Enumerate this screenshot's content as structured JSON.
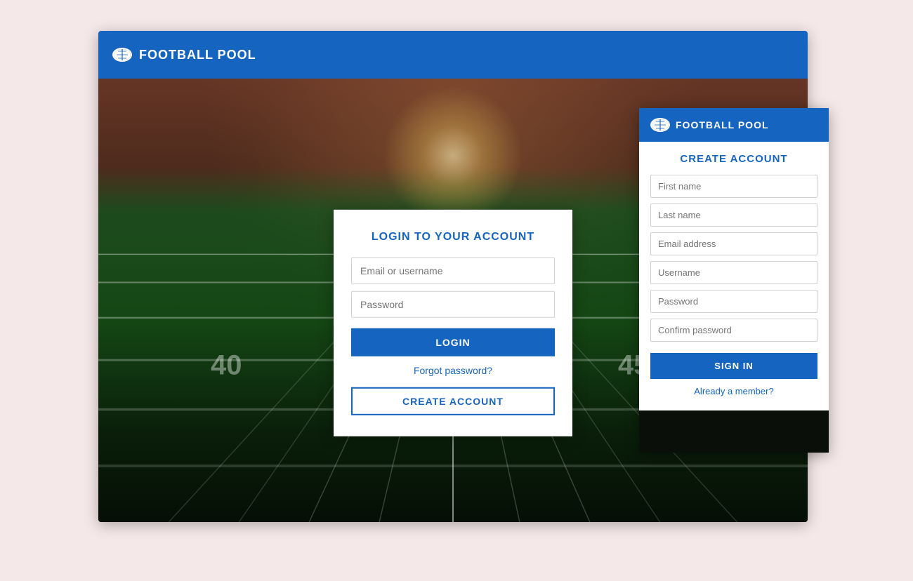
{
  "colors": {
    "primary": "#1565c0",
    "white": "#ffffff",
    "bg": "#f5e8e8"
  },
  "main_app": {
    "header": {
      "logo_icon": "football-icon",
      "title": "FOOTBALL POOL"
    },
    "login_form": {
      "title": "LOGIN TO YOUR ACCOUNT",
      "email_placeholder": "Email or username",
      "password_placeholder": "Password",
      "login_button": "LOGIN",
      "forgot_password": "Forgot password?",
      "create_account_button": "CREATE ACCOUNT"
    }
  },
  "secondary_app": {
    "header": {
      "logo_icon": "football-icon",
      "title": "FOOTBALL POOL"
    },
    "create_form": {
      "title": "CREATE ACCOUNT",
      "first_name_placeholder": "First name",
      "last_name_placeholder": "Last name",
      "email_placeholder": "Email address",
      "username_placeholder": "Username",
      "password_placeholder": "Password",
      "confirm_password_placeholder": "Confirm password",
      "sign_in_button": "SIGN IN",
      "already_member": "Already a member?"
    }
  }
}
